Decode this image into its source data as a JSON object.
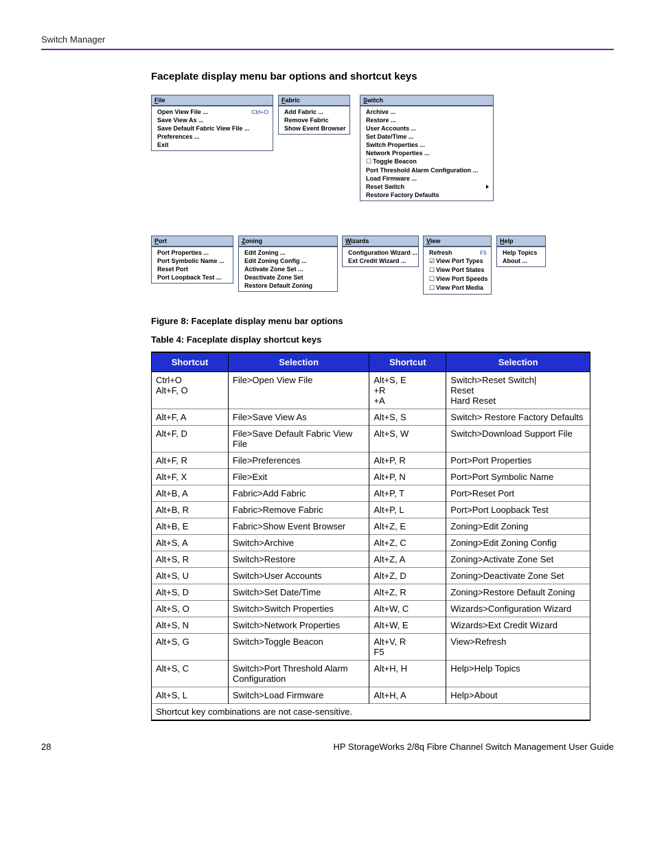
{
  "running_head": "Switch Manager",
  "section_title": "Faceplate display menu bar options and shortcut keys",
  "figure_caption": "Figure 8:  Faceplate display menu bar options",
  "table_caption": "Table 4:  Faceplate display shortcut keys",
  "page_number": "28",
  "doc_title": "HP StorageWorks 2/8q Fibre Channel Switch Management User Guide",
  "table_headers": {
    "c1": "Shortcut",
    "c2": "Selection",
    "c3": "Shortcut",
    "c4": "Selection"
  },
  "note": "Shortcut key combinations are not case-sensitive.",
  "menus": {
    "file": {
      "title": "File",
      "items": [
        {
          "label": "Open View File ...",
          "hint": "Ctrl+O"
        },
        {
          "label": "Save View As ...",
          "hint": ""
        },
        {
          "label": "Save Default Fabric View File ...",
          "hint": ""
        },
        {
          "label": "Preferences ...",
          "hint": ""
        },
        {
          "label": "Exit",
          "hint": ""
        }
      ]
    },
    "fabric": {
      "title": "Fabric",
      "items": [
        {
          "label": "Add Fabric ...",
          "hint": ""
        },
        {
          "label": "Remove Fabric",
          "hint": ""
        },
        {
          "label": "Show Event Browser",
          "hint": ""
        }
      ]
    },
    "switch": {
      "title": "Switch",
      "items": [
        {
          "label": "Archive ...",
          "hint": ""
        },
        {
          "label": "Restore ...",
          "hint": ""
        },
        {
          "label": "User Accounts ...",
          "hint": ""
        },
        {
          "label": "Set Date/Time ...",
          "hint": ""
        },
        {
          "label": "Switch Properties ...",
          "hint": ""
        },
        {
          "label": "Network Properties ...",
          "hint": ""
        },
        {
          "label": "Toggle Beacon",
          "hint": "",
          "checkbox": true
        },
        {
          "label": "Port Threshold Alarm Configuration ...",
          "hint": ""
        },
        {
          "label": "Load Firmware ...",
          "hint": ""
        },
        {
          "label": "Reset Switch",
          "hint": "",
          "submenu": true
        },
        {
          "label": "Restore Factory Defaults",
          "hint": ""
        }
      ]
    },
    "port": {
      "title": "Port",
      "items": [
        {
          "label": "Port Properties ...",
          "hint": ""
        },
        {
          "label": "Port Symbolic Name ...",
          "hint": ""
        },
        {
          "label": "Reset Port",
          "hint": ""
        },
        {
          "label": "Port Loopback Test ...",
          "hint": ""
        }
      ]
    },
    "zoning": {
      "title": "Zoning",
      "items": [
        {
          "label": "Edit Zoning ...",
          "hint": ""
        },
        {
          "label": "Edit Zoning Config ...",
          "hint": ""
        },
        {
          "label": "Activate Zone Set ...",
          "hint": ""
        },
        {
          "label": "Deactivate Zone Set",
          "hint": ""
        },
        {
          "label": "Restore Default Zoning",
          "hint": ""
        }
      ]
    },
    "wizards": {
      "title": "Wizards",
      "items": [
        {
          "label": "Configuration Wizard ...",
          "hint": ""
        },
        {
          "label": "Ext Credit Wizard ...",
          "hint": ""
        }
      ]
    },
    "view": {
      "title": "View",
      "items": [
        {
          "label": "Refresh",
          "hint": "F5"
        },
        {
          "label": "View Port Types",
          "hint": "",
          "checkbox": true,
          "checked": true
        },
        {
          "label": "View Port States",
          "hint": "",
          "checkbox": true
        },
        {
          "label": "View Port Speeds",
          "hint": "",
          "checkbox": true
        },
        {
          "label": "View Port Media",
          "hint": "",
          "checkbox": true
        }
      ]
    },
    "help": {
      "title": "Help",
      "items": [
        {
          "label": "Help Topics",
          "hint": ""
        },
        {
          "label": "About ...",
          "hint": ""
        }
      ]
    }
  },
  "rows": [
    {
      "s1": "Ctrl+O\nAlt+F, O",
      "sel1": "File>Open View File",
      "s2": "Alt+S, E\n+R\n+A",
      "sel2": "Switch>Reset Switch|\nReset\nHard Reset"
    },
    {
      "s1": "Alt+F, A",
      "sel1": "File>Save View As",
      "s2": "Alt+S, S",
      "sel2": "Switch> Restore Factory Defaults"
    },
    {
      "s1": "Alt+F, D",
      "sel1": "File>Save Default Fabric View File",
      "s2": "Alt+S, W",
      "sel2": "Switch>Download Support File"
    },
    {
      "s1": "Alt+F, R",
      "sel1": "File>Preferences",
      "s2": "Alt+P, R",
      "sel2": "Port>Port Properties"
    },
    {
      "s1": "Alt+F, X",
      "sel1": "File>Exit",
      "s2": "Alt+P, N",
      "sel2": "Port>Port Symbolic Name"
    },
    {
      "s1": "Alt+B, A",
      "sel1": "Fabric>Add Fabric",
      "s2": "Alt+P, T",
      "sel2": "Port>Reset Port"
    },
    {
      "s1": "Alt+B, R",
      "sel1": "Fabric>Remove Fabric",
      "s2": "Alt+P, L",
      "sel2": "Port>Port Loopback Test"
    },
    {
      "s1": "Alt+B, E",
      "sel1": "Fabric>Show Event Browser",
      "s2": "Alt+Z, E",
      "sel2": "Zoning>Edit Zoning"
    },
    {
      "s1": "Alt+S, A",
      "sel1": "Switch>Archive",
      "s2": "Alt+Z, C",
      "sel2": "Zoning>Edit Zoning Config"
    },
    {
      "s1": "Alt+S, R",
      "sel1": "Switch>Restore",
      "s2": "Alt+Z, A",
      "sel2": "Zoning>Activate Zone Set"
    },
    {
      "s1": "Alt+S, U",
      "sel1": "Switch>User Accounts",
      "s2": "Alt+Z, D",
      "sel2": "Zoning>Deactivate Zone Set"
    },
    {
      "s1": "Alt+S, D",
      "sel1": "Switch>Set Date/Time",
      "s2": "Alt+Z, R",
      "sel2": "Zoning>Restore Default Zoning"
    },
    {
      "s1": "Alt+S, O",
      "sel1": "Switch>Switch Properties",
      "s2": "Alt+W, C",
      "sel2": "Wizards>Configuration Wizard"
    },
    {
      "s1": "Alt+S, N",
      "sel1": "Switch>Network Properties",
      "s2": "Alt+W, E",
      "sel2": "Wizards>Ext Credit Wizard"
    },
    {
      "s1": "Alt+S, G",
      "sel1": "Switch>Toggle Beacon",
      "s2": "Alt+V, R\nF5",
      "sel2": "View>Refresh"
    },
    {
      "s1": "Alt+S, C",
      "sel1": "Switch>Port Threshold Alarm Configuration",
      "s2": "Alt+H, H",
      "sel2": "Help>Help Topics"
    },
    {
      "s1": "Alt+S, L",
      "sel1": "Switch>Load Firmware",
      "s2": "Alt+H, A",
      "sel2": "Help>About"
    }
  ]
}
